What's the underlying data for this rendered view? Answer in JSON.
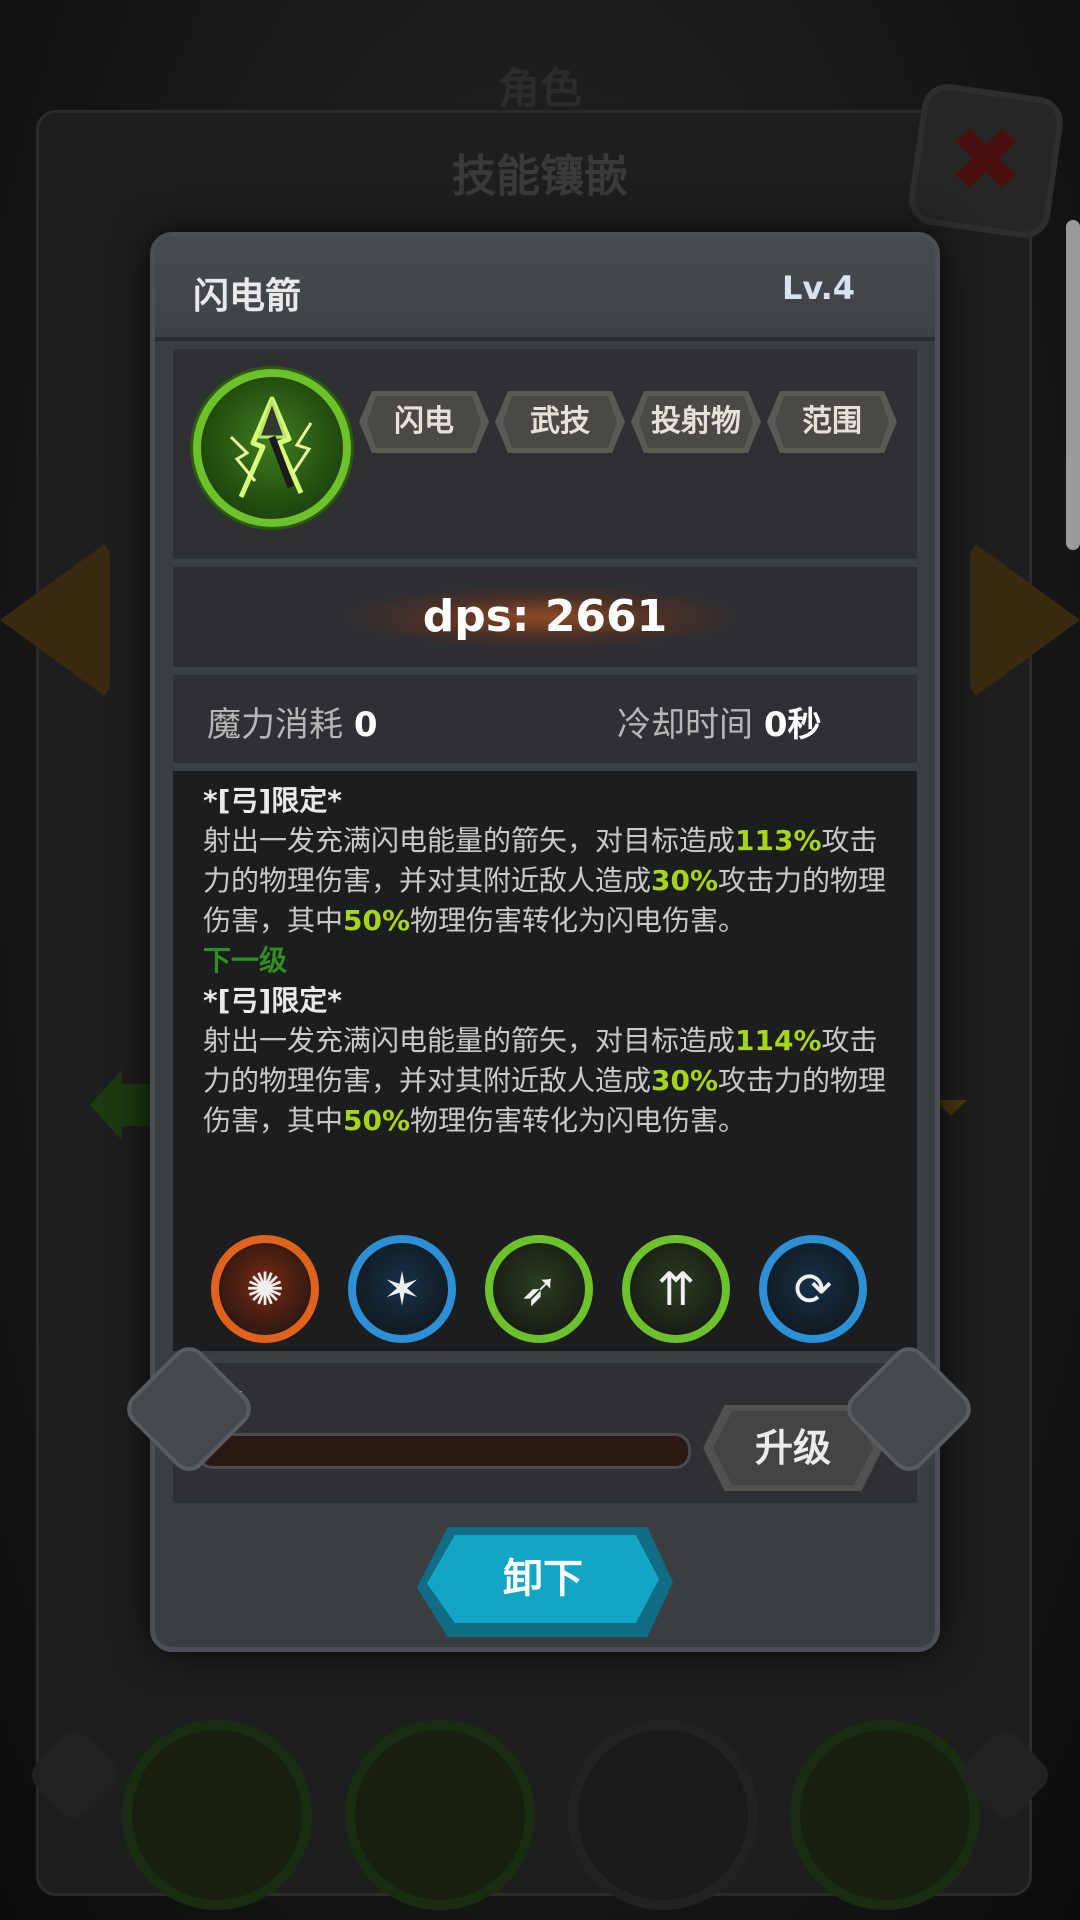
{
  "background": {
    "title_role": "角色",
    "title_skill": "技能镶嵌",
    "close_symbol": "✖"
  },
  "modal": {
    "skill_name": "闪电箭",
    "level": "Lv.4",
    "icon": "lightning-arrow-icon",
    "tags": [
      "闪电",
      "武技",
      "投射物",
      "范围"
    ],
    "dps": "dps: 2661",
    "mana_label": "魔力消耗",
    "mana_value": "0",
    "cooldown_label": "冷却时间",
    "cooldown_value": "0秒",
    "description": {
      "current_limit": "*[弓]限定*",
      "current_parts": [
        {
          "text": "射出一发充满闪电能量的箭矢，对目标造成",
          "hl": false
        },
        {
          "text": "113%",
          "hl": true
        },
        {
          "text": "攻击力的物理伤害，并对其附近敌人造成",
          "hl": false
        },
        {
          "text": "30%",
          "hl": true
        },
        {
          "text": "攻击力的物理伤害，其中",
          "hl": false
        },
        {
          "text": "50%",
          "hl": true
        },
        {
          "text": "物理伤害转化为闪电伤害。",
          "hl": false
        }
      ],
      "next_level_label": "下一级",
      "next_limit": "*[弓]限定*",
      "next_parts": [
        {
          "text": "射出一发充满闪电能量的箭矢，对目标造成",
          "hl": false
        },
        {
          "text": "114%",
          "hl": true
        },
        {
          "text": "攻击力的物理伤害，并对其附近敌人造成",
          "hl": false
        },
        {
          "text": "30%",
          "hl": true
        },
        {
          "text": "攻击力的物理伤害，其中",
          "hl": false
        },
        {
          "text": "50%",
          "hl": true
        },
        {
          "text": "物理伤害转化为闪电伤害。",
          "hl": false
        }
      ]
    },
    "gems": [
      {
        "name": "sun-burst-icon",
        "ring": "#e0621c",
        "fill": "#7a2a12"
      },
      {
        "name": "shattered-arrow-icon",
        "ring": "#2d8fd6",
        "fill": "#15314a"
      },
      {
        "name": "spinning-arrow-icon",
        "ring": "#6dc12b",
        "fill": "#2b3d20"
      },
      {
        "name": "multi-arrow-icon",
        "ring": "#6dc12b",
        "fill": "#2b3d20"
      },
      {
        "name": "cycle-arrows-icon",
        "ring": "#2d8fd6",
        "fill": "#15314a"
      }
    ],
    "progress_text": "0/1",
    "progress_fraction": 0,
    "upgrade_label": "升级",
    "unload_label": "卸下"
  }
}
